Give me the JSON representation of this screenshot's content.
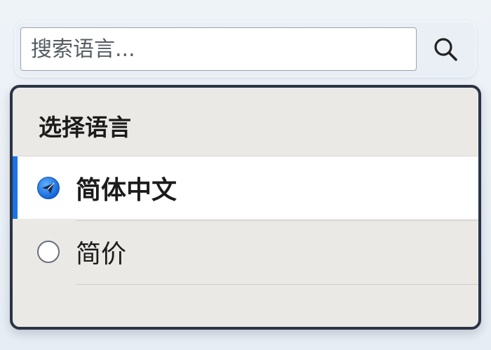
{
  "search": {
    "placeholder": "搜索语言...",
    "button_icon": "search-icon"
  },
  "panel": {
    "title": "选择语言",
    "options": [
      {
        "label": "简体中文",
        "selected": true,
        "icon": "radio-selected-icon"
      },
      {
        "label": "简价",
        "selected": false,
        "icon": "radio-unselected-icon"
      }
    ]
  },
  "colors": {
    "accent": "#1a73e8",
    "panel_border": "#2a3445"
  }
}
